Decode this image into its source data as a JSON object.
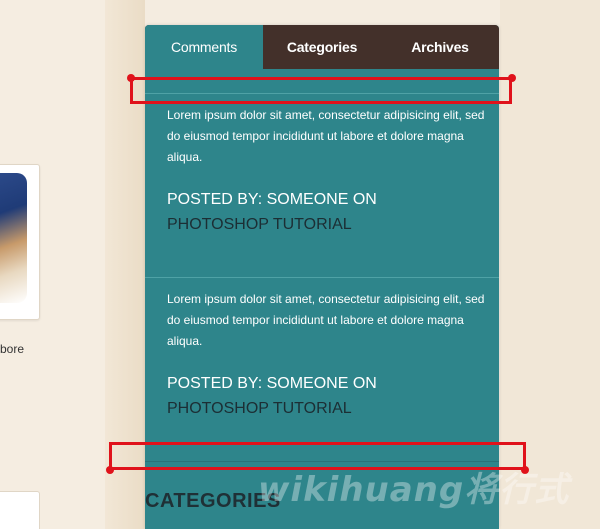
{
  "sidebar_left": {
    "caption": "bore"
  },
  "widget": {
    "tabs": [
      {
        "label": "Comments"
      },
      {
        "label": "Categories"
      },
      {
        "label": "Archives"
      }
    ],
    "posts": [
      {
        "body": "Lorem ipsum dolor sit amet, consectetur adipisicing elit, sed do eiusmod tempor incididunt ut labore et dolore magna aliqua.",
        "posted_by": "POSTED BY: SOMEONE ON",
        "link": "PHOTOSHOP TUTORIAL"
      },
      {
        "body": "Lorem ipsum dolor sit amet, consectetur adipisicing elit, sed do eiusmod tempor incididunt ut labore et dolore magna aliqua.",
        "posted_by": "POSTED BY: SOMEONE ON",
        "link": "PHOTOSHOP TUTORIAL"
      }
    ],
    "section_title": "CATEGORIES"
  },
  "watermark": "wikihuang将行式",
  "colors": {
    "accent_teal": "#2e858b",
    "tab_bar_brown": "#43302a",
    "annotation_red": "#e0121b",
    "page_bg": "#f4ece0"
  }
}
